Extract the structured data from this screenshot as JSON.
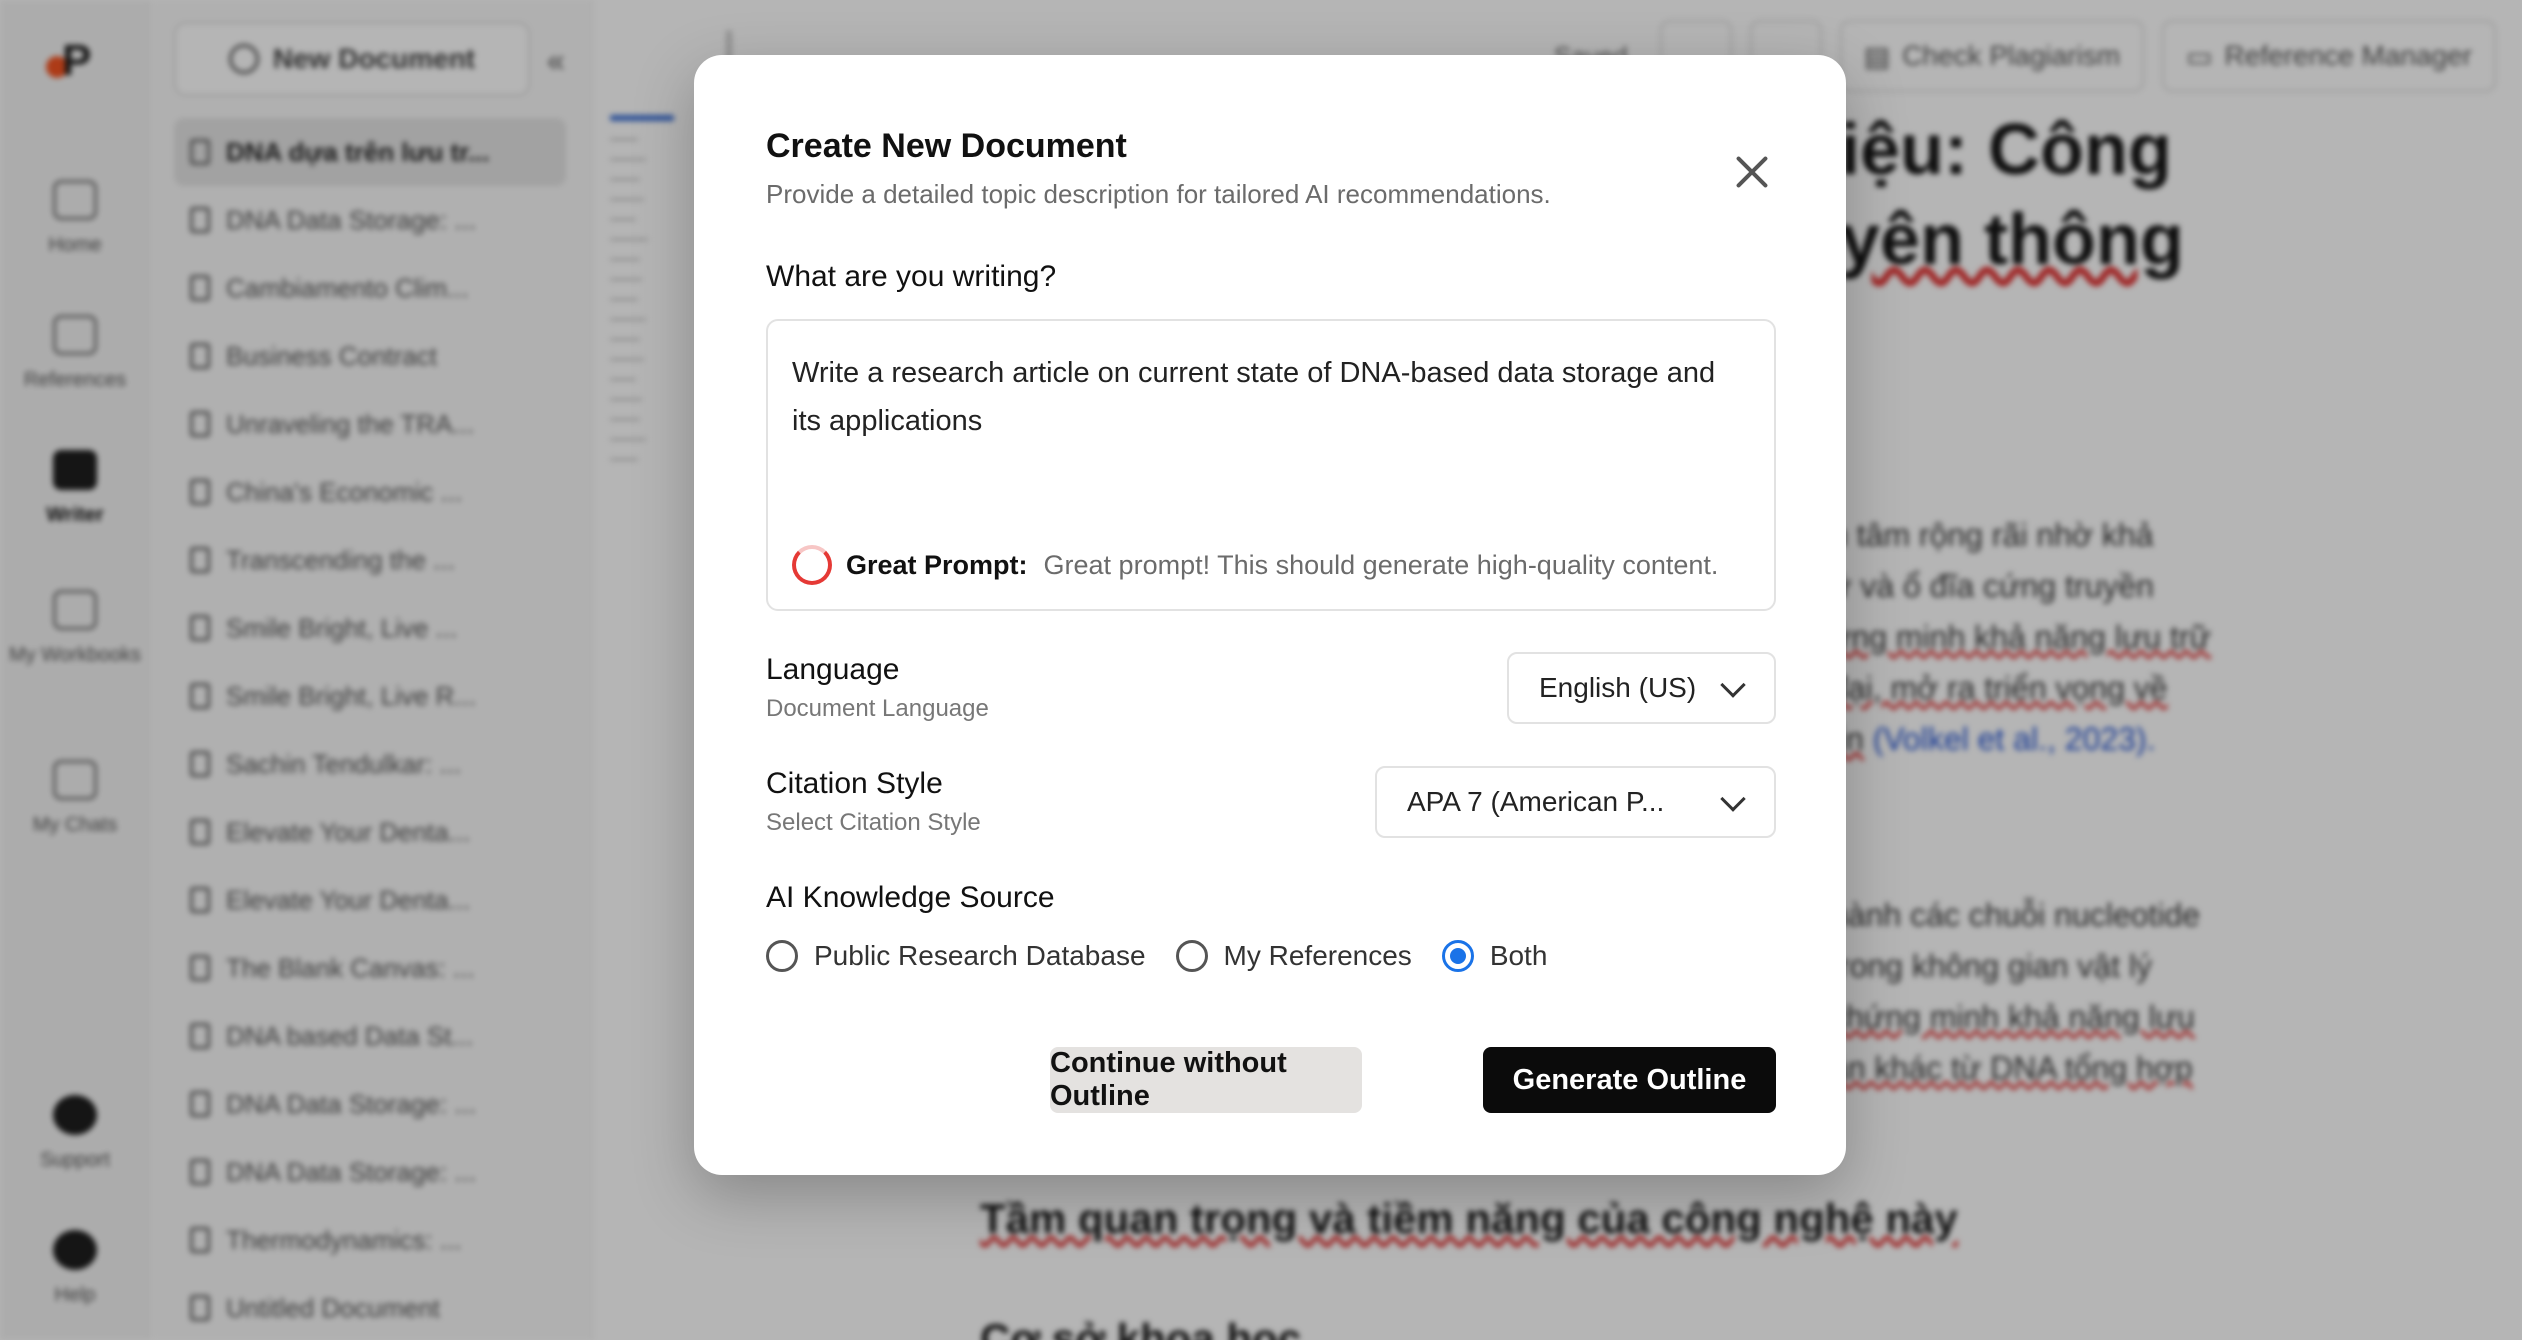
{
  "app": {
    "logo_letter": "P",
    "rail": [
      {
        "label": "Home",
        "icon": "home-icon"
      },
      {
        "label": "References",
        "icon": "folder-icon"
      },
      {
        "label": "Writer",
        "icon": "writer-icon"
      },
      {
        "label": "My Workbooks",
        "icon": "calendar-icon"
      },
      {
        "label": "My Chats",
        "icon": "chat-icon"
      },
      {
        "label": "Support",
        "icon": "support-icon"
      },
      {
        "label": "Help",
        "icon": "help-icon"
      }
    ],
    "new_document_label": "New Document",
    "documents": [
      "DNA dựa trên lưu tr...",
      "DNA Data Storage: ...",
      "Cambiamento Clim...",
      "Business Contract",
      "Unraveling the TRA...",
      "China's Economic ...",
      "Transcending the ...",
      "Smile Bright, Live ...",
      "Smile Bright, Live R...",
      "Sachin Tendulkar: ...",
      "Elevate Your Denta...",
      "Elevate Your Denta...",
      "The Blank Canvas: ...",
      "DNA based Data St...",
      "DNA Data Storage: ...",
      "DNA Data Storage: ...",
      "Thermodynamics: ...",
      "Untitled Document"
    ],
    "topbar": {
      "saved": "Saved",
      "plagiarism": "Check Plagiarism",
      "reference_manager": "Reference Manager"
    },
    "editor": {
      "title_line1": "iệu: Công",
      "title_line2": "yên thông",
      "para1": [
        "n tâm rộng rãi nhờ khả",
        "ữ và ổ đĩa cứng truyền",
        "ứng minh khả năng lưu trữ",
        "đại, mở ra triển vọng về",
        "tin"
      ],
      "citation": "(Volkel et al., 2023).",
      "para2": [
        "hành các chuỗi nucleotide",
        "trong không gian vật lý",
        "chứng minh khả năng lưu",
        "ản khác từ DNA tổng hợp"
      ],
      "heading1": "Tầm quan trọng và tiềm năng của công nghệ này",
      "heading2": "Cơ sở khoa học"
    }
  },
  "modal": {
    "title": "Create New Document",
    "subtitle": "Provide a detailed topic description for tailored AI recommendations.",
    "question_label": "What are you writing?",
    "prompt_value": "Write a research article on current state of DNA-based data storage and its applications",
    "quality_label": "Great Prompt:",
    "quality_message": "Great prompt! This should generate high-quality content.",
    "language": {
      "label": "Language",
      "sublabel": "Document Language",
      "value": "English (US)"
    },
    "citation": {
      "label": "Citation Style",
      "sublabel": "Select Citation Style",
      "value": "APA 7 (American P..."
    },
    "knowledge": {
      "label": "AI Knowledge Source",
      "options": [
        "Public Research Database",
        "My References",
        "Both"
      ],
      "selected": "Both"
    },
    "buttons": {
      "secondary": "Continue without Outline",
      "primary": "Generate Outline"
    },
    "colors": {
      "primary_button": "#0b0b0b",
      "radio_selected": "#1a73e8",
      "prompt_ring": "#e53935"
    }
  }
}
